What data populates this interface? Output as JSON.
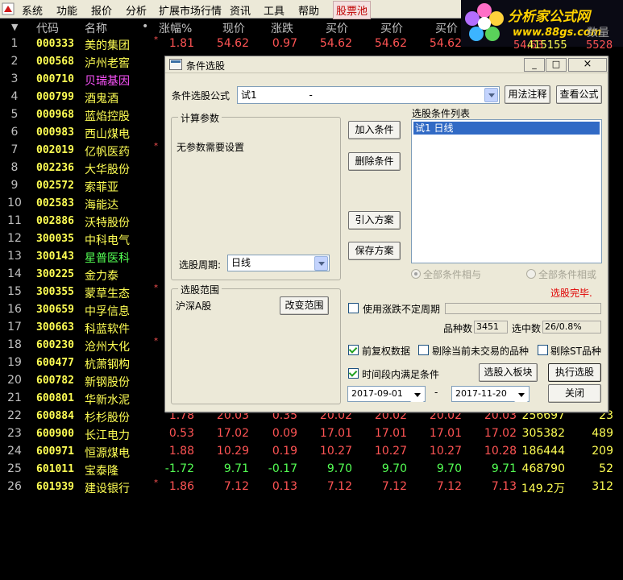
{
  "menubar": {
    "items": [
      "系统",
      "功能",
      "报价",
      "分析",
      "扩展市场行情",
      "资讯",
      "工具",
      "帮助"
    ],
    "highlight": "股票池"
  },
  "brand": {
    "title": "分析家公式网",
    "url": "www.88gs.com"
  },
  "grid": {
    "headers": {
      "sort_arrow": "▼",
      "code": "代码",
      "name": "名称",
      "dot": "•",
      "pct": "涨幅%",
      "price": "现价",
      "change": "涨跌",
      "bid": "买价",
      "ask": "买价",
      "ask2": "买价"
    },
    "partial": {
      "r1_vol": "415155",
      "r1_amt": "5528",
      "r1_sell": "54.63",
      "hdr_tail": "数量"
    },
    "rows": [
      {
        "no": "1",
        "code": "000333",
        "name": "美的集团",
        "name_style": "",
        "mark": "*",
        "pct": "1.81",
        "price": "54.62",
        "chg": "0.97",
        "bid": "54.62",
        "ask": "54.62",
        "ask2": "54.62",
        "sell": "",
        "vol": "",
        "amt": "",
        "dir": "up"
      },
      {
        "no": "2",
        "code": "000568",
        "name": "泸州老窖",
        "name_style": "",
        "mark": "",
        "pct": "",
        "price": "",
        "chg": "",
        "bid": "",
        "ask": "",
        "ask2": "",
        "sell": "",
        "vol": "",
        "amt": "",
        "dir": ""
      },
      {
        "no": "3",
        "code": "000710",
        "name": "贝瑞基因",
        "name_style": "alt",
        "mark": "",
        "pct": "",
        "price": "",
        "chg": "",
        "bid": "",
        "ask": "",
        "ask2": "",
        "sell": "",
        "vol": "",
        "amt": "",
        "dir": ""
      },
      {
        "no": "4",
        "code": "000799",
        "name": "酒鬼酒",
        "name_style": "",
        "mark": "",
        "pct": "",
        "price": "",
        "chg": "",
        "bid": "",
        "ask": "",
        "ask2": "",
        "sell": "",
        "vol": "",
        "amt": "",
        "dir": ""
      },
      {
        "no": "5",
        "code": "000968",
        "name": "蓝焰控股",
        "name_style": "",
        "mark": "",
        "pct": "",
        "price": "",
        "chg": "",
        "bid": "",
        "ask": "",
        "ask2": "",
        "sell": "",
        "vol": "",
        "amt": "",
        "dir": ""
      },
      {
        "no": "6",
        "code": "000983",
        "name": "西山煤电",
        "name_style": "",
        "mark": "",
        "pct": "",
        "price": "",
        "chg": "",
        "bid": "",
        "ask": "",
        "ask2": "",
        "sell": "",
        "vol": "",
        "amt": "",
        "dir": ""
      },
      {
        "no": "7",
        "code": "002019",
        "name": "亿帆医药",
        "name_style": "",
        "mark": "*",
        "pct": "",
        "price": "",
        "chg": "",
        "bid": "",
        "ask": "",
        "ask2": "",
        "sell": "",
        "vol": "",
        "amt": "",
        "dir": ""
      },
      {
        "no": "8",
        "code": "002236",
        "name": "大华股份",
        "name_style": "",
        "mark": "",
        "pct": "",
        "price": "",
        "chg": "",
        "bid": "",
        "ask": "",
        "ask2": "",
        "sell": "",
        "vol": "",
        "amt": "",
        "dir": ""
      },
      {
        "no": "9",
        "code": "002572",
        "name": "索菲亚",
        "name_style": "",
        "mark": "",
        "pct": "",
        "price": "",
        "chg": "",
        "bid": "",
        "ask": "",
        "ask2": "",
        "sell": "",
        "vol": "",
        "amt": "",
        "dir": ""
      },
      {
        "no": "10",
        "code": "002583",
        "name": "海能达",
        "name_style": "",
        "mark": "",
        "pct": "",
        "price": "",
        "chg": "",
        "bid": "",
        "ask": "",
        "ask2": "",
        "sell": "",
        "vol": "",
        "amt": "",
        "dir": ""
      },
      {
        "no": "11",
        "code": "002886",
        "name": "沃特股份",
        "name_style": "",
        "mark": "",
        "pct": "",
        "price": "",
        "chg": "",
        "bid": "",
        "ask": "",
        "ask2": "",
        "sell": "",
        "vol": "",
        "amt": "",
        "dir": ""
      },
      {
        "no": "12",
        "code": "300035",
        "name": "中科电气",
        "name_style": "",
        "mark": "",
        "pct": "",
        "price": "",
        "chg": "",
        "bid": "",
        "ask": "",
        "ask2": "",
        "sell": "",
        "vol": "",
        "amt": "",
        "dir": ""
      },
      {
        "no": "13",
        "code": "300143",
        "name": "星普医科",
        "name_style": "green",
        "mark": "",
        "pct": "",
        "price": "",
        "chg": "",
        "bid": "",
        "ask": "",
        "ask2": "",
        "sell": "",
        "vol": "",
        "amt": "",
        "dir": ""
      },
      {
        "no": "14",
        "code": "300225",
        "name": "金力泰",
        "name_style": "",
        "mark": "",
        "pct": "",
        "price": "",
        "chg": "",
        "bid": "",
        "ask": "",
        "ask2": "",
        "sell": "",
        "vol": "",
        "amt": "",
        "dir": ""
      },
      {
        "no": "15",
        "code": "300355",
        "name": "蒙草生态",
        "name_style": "",
        "mark": "*",
        "pct": "",
        "price": "",
        "chg": "",
        "bid": "",
        "ask": "",
        "ask2": "",
        "sell": "",
        "vol": "",
        "amt": "",
        "dir": ""
      },
      {
        "no": "16",
        "code": "300659",
        "name": "中孚信息",
        "name_style": "",
        "mark": "",
        "pct": "",
        "price": "",
        "chg": "",
        "bid": "",
        "ask": "",
        "ask2": "",
        "sell": "",
        "vol": "",
        "amt": "",
        "dir": ""
      },
      {
        "no": "17",
        "code": "300663",
        "name": "科蓝软件",
        "name_style": "",
        "mark": "",
        "pct": "",
        "price": "",
        "chg": "",
        "bid": "",
        "ask": "",
        "ask2": "",
        "sell": "",
        "vol": "",
        "amt": "",
        "dir": ""
      },
      {
        "no": "18",
        "code": "600230",
        "name": "沧州大化",
        "name_style": "",
        "mark": "*",
        "pct": "",
        "price": "",
        "chg": "",
        "bid": "",
        "ask": "",
        "ask2": "",
        "sell": "",
        "vol": "",
        "amt": "",
        "dir": ""
      },
      {
        "no": "19",
        "code": "600477",
        "name": "杭萧钢构",
        "name_style": "",
        "mark": "",
        "pct": "",
        "price": "",
        "chg": "",
        "bid": "",
        "ask": "",
        "ask2": "",
        "sell": "",
        "vol": "",
        "amt": "",
        "dir": ""
      },
      {
        "no": "20",
        "code": "600782",
        "name": "新钢股份",
        "name_style": "",
        "mark": "",
        "pct": "",
        "price": "",
        "chg": "",
        "bid": "",
        "ask": "",
        "ask2": "",
        "sell": "",
        "vol": "",
        "amt": "",
        "dir": ""
      },
      {
        "no": "21",
        "code": "600801",
        "name": "华新水泥",
        "name_style": "",
        "mark": "",
        "pct": "",
        "price": "",
        "chg": "",
        "bid": "",
        "ask": "",
        "ask2": "",
        "sell": "",
        "vol": "",
        "amt": "",
        "dir": ""
      },
      {
        "no": "22",
        "code": "600884",
        "name": "杉杉股份",
        "name_style": "",
        "mark": "",
        "pct": "1.78",
        "price": "20.03",
        "chg": "0.35",
        "bid": "20.02",
        "ask": "20.02",
        "ask2": "20.02",
        "sell": "20.03",
        "vol": "256697",
        "amt": "23",
        "dir": "up"
      },
      {
        "no": "23",
        "code": "600900",
        "name": "长江电力",
        "name_style": "",
        "mark": "",
        "pct": "0.53",
        "price": "17.02",
        "chg": "0.09",
        "bid": "17.01",
        "ask": "17.01",
        "ask2": "17.01",
        "sell": "17.02",
        "vol": "305382",
        "amt": "489",
        "dir": "up"
      },
      {
        "no": "24",
        "code": "600971",
        "name": "恒源煤电",
        "name_style": "",
        "mark": "",
        "pct": "1.88",
        "price": "10.29",
        "chg": "0.19",
        "bid": "10.27",
        "ask": "10.27",
        "ask2": "10.27",
        "sell": "10.28",
        "vol": "186444",
        "amt": "209",
        "dir": "up"
      },
      {
        "no": "25",
        "code": "601011",
        "name": "宝泰隆",
        "name_style": "",
        "mark": "",
        "pct": "-1.72",
        "price": "9.71",
        "chg": "-0.17",
        "bid": "9.70",
        "ask": "9.70",
        "ask2": "9.70",
        "sell": "9.71",
        "vol": "468790",
        "amt": "52",
        "dir": "dn"
      },
      {
        "no": "26",
        "code": "601939",
        "name": "建设银行",
        "name_style": "",
        "mark": "*",
        "pct": "1.86",
        "price": "7.12",
        "chg": "0.13",
        "bid": "7.12",
        "ask": "7.12",
        "ask2": "7.12",
        "sell": "7.13",
        "vol": "149.2万",
        "amt": "312",
        "dir": "up"
      }
    ]
  },
  "dialog": {
    "title": "条件选股",
    "min": "_",
    "max": "□",
    "close": "×",
    "formula_label": "条件选股公式",
    "formula_value": "试1                 -",
    "btn_usage": "用法注释",
    "btn_view": "查看公式",
    "params_title": "计算参数",
    "params_text": "无参数需要设置",
    "period_label": "选股周期:",
    "period_value": "日线",
    "btn_add": "加入条件",
    "btn_delete": "删除条件",
    "btn_import": "引入方案",
    "btn_save": "保存方案",
    "list_title": "选股条件列表",
    "list_items": [
      "试1   日线"
    ],
    "radio_and": "全部条件相与",
    "radio_or": "全部条件相或",
    "status": "选股完毕.",
    "range_title": "选股范围",
    "range_value": "沪深A股",
    "btn_change_range": "改变范围",
    "use_uncertain": "使用涨跌不定周期",
    "count_label": "品种数",
    "count_value": "3451",
    "selected_label": "选中数",
    "selected_value": "26/0.8%",
    "chk_preadjust": "前复权数据",
    "chk_exclude_untraded": "剔除当前未交易的品种",
    "chk_exclude_st": "剔除ST品种",
    "chk_timerange": "时间段内满足条件",
    "btn_to_board": "选股入板块",
    "btn_run": "执行选股",
    "date_from": "2017-09-01",
    "date_sep": "-",
    "date_to": "2017-11-20",
    "btn_close": "关闭"
  }
}
